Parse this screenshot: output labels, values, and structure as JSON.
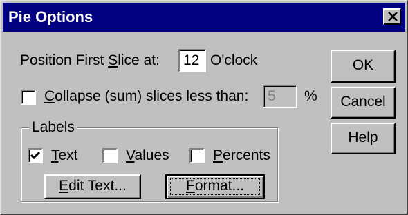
{
  "dialog": {
    "title": "Pie Options",
    "close_icon": "close-icon"
  },
  "position": {
    "label_before": "Position First ",
    "label_accel": "S",
    "label_after": "lice at:",
    "value": "12",
    "unit": "O'clock"
  },
  "collapse": {
    "checked": false,
    "label_accel": "C",
    "label_after": "ollapse (sum) slices less than:",
    "value": "5",
    "unit": "%"
  },
  "labels_group": {
    "title": "Labels",
    "text": {
      "checked": true,
      "accel": "T",
      "rest": "ext"
    },
    "values": {
      "checked": false,
      "accel": "V",
      "rest": "alues"
    },
    "percents": {
      "checked": false,
      "accel": "P",
      "rest": "ercents"
    },
    "edit_text": {
      "accel": "E",
      "rest": "dit Text..."
    },
    "format": {
      "accel": "F",
      "rest": "ormat..."
    }
  },
  "buttons": {
    "ok": "OK",
    "cancel": "Cancel",
    "help": "Help"
  },
  "colors": {
    "titlebar": "#000080",
    "face": "#c0c0c0"
  }
}
